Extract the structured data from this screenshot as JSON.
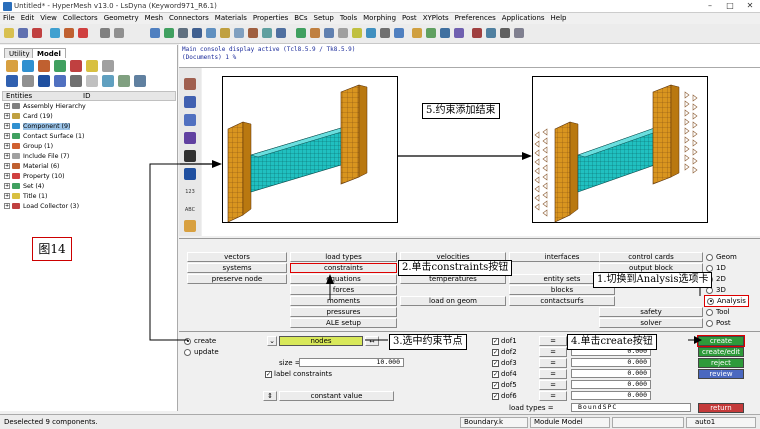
{
  "window": {
    "title": "Untitled* - HyperMesh v13.0 - LsDyna (Keyword971_R6.1)"
  },
  "menu": [
    "File",
    "Edit",
    "View",
    "Collectors",
    "Geometry",
    "Mesh",
    "Connectors",
    "Materials",
    "Properties",
    "BCs",
    "Setup",
    "Tools",
    "Morphing",
    "Post",
    "XYPlots",
    "Preferences",
    "Applications",
    "Help"
  ],
  "left_panel": {
    "tabs": [
      "Utility",
      "Model"
    ],
    "header": {
      "col1": "Entities",
      "col2": "ID"
    },
    "tree": [
      "Assembly Hierarchy",
      "Card (19)",
      "Component (9)",
      "Contact Surface (1)",
      "Group (1)",
      "Include File (7)",
      "Material (6)",
      "Property (10)",
      "Set (4)",
      "Title (1)",
      "Load Collector (3)"
    ],
    "figure_label": "图14"
  },
  "console": {
    "line1": "Main console display active (Tcl8.5.9 / Tk8.5.9)",
    "line2": "(Documents) 1 %"
  },
  "callouts": {
    "c1": "1.切换到Analysis选项卡",
    "c2": "2.单击constraints按钮",
    "c3": "3.选中约束节点",
    "c4": "4.单击create按钮",
    "c5": "5.约束添加结束"
  },
  "vstrip_label_123": "123",
  "vstrip_label_abc": "ABC",
  "analysis_panel": {
    "col1": [
      "vectors",
      "systems",
      "preserve node"
    ],
    "col2": [
      "load types",
      "constraints",
      "equations",
      "forces",
      "moments",
      "pressures",
      "ALE setup"
    ],
    "col3": [
      "velocities",
      "temperatures",
      "load on geom"
    ],
    "col4": [
      "interfaces",
      "entity sets",
      "blocks",
      "contactsurfs"
    ],
    "col5": [
      "control cards",
      "output block",
      "safety",
      "solver"
    ],
    "radios": [
      "Geom",
      "1D",
      "2D",
      "3D",
      "Analysis",
      "Tool",
      "Post"
    ]
  },
  "constraint_panel": {
    "create": "create",
    "update": "update",
    "nodes": "nodes",
    "size_label": "size =",
    "size_value": "10.000",
    "label_constraints": "label constraints",
    "constant_value": "constant value",
    "dofs": [
      "dof1",
      "dof2",
      "dof3",
      "dof4",
      "dof5",
      "dof6"
    ],
    "eq": "=",
    "dof_value": "0.000",
    "load_types_label": "load types =",
    "load_types_value": "BoundSPC",
    "buttons": [
      "create",
      "create/edit",
      "reject",
      "review"
    ],
    "return": "return"
  },
  "status": {
    "message": "Deselected 9 components.",
    "file": "Boundary.k",
    "module": "Module Model",
    "auto": "auto1"
  },
  "colors": {
    "create_btn": "#2e9a3a",
    "review_btn": "#4a68c0",
    "return_btn": "#c43a3a",
    "nodes_btn": "#d8e85a",
    "selection": "#9cc4e8",
    "beam": "#20c0c0",
    "wall": "#d9951f"
  }
}
